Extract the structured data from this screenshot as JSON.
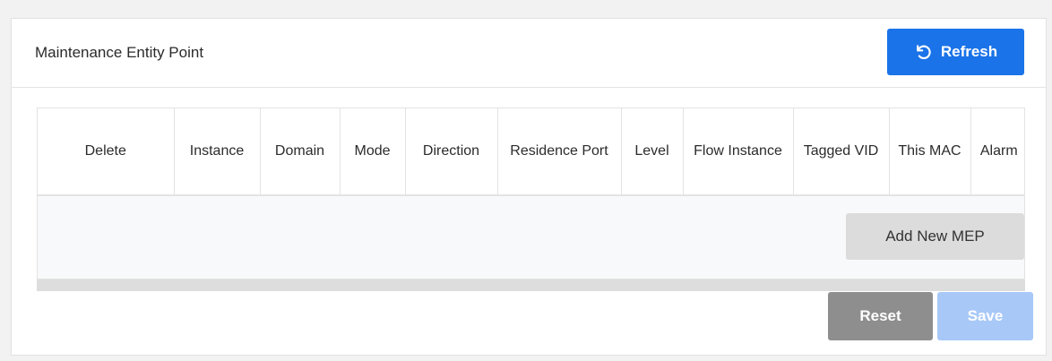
{
  "panel": {
    "title": "Maintenance Entity Point",
    "refresh_label": "Refresh",
    "refresh_icon": "refresh-icon",
    "accent_color": "#1a73e8"
  },
  "table": {
    "columns": [
      {
        "label": "Delete"
      },
      {
        "label": "Instance"
      },
      {
        "label": "Domain"
      },
      {
        "label": "Mode"
      },
      {
        "label": "Direction"
      },
      {
        "label": "Residence Port"
      },
      {
        "label": "Level"
      },
      {
        "label": "Flow Instance"
      },
      {
        "label": "Tagged VID"
      },
      {
        "label": "This MAC"
      },
      {
        "label": "Alarm"
      }
    ],
    "rows": [],
    "add_label": "Add New MEP"
  },
  "footer": {
    "reset_label": "Reset",
    "save_label": "Save"
  }
}
